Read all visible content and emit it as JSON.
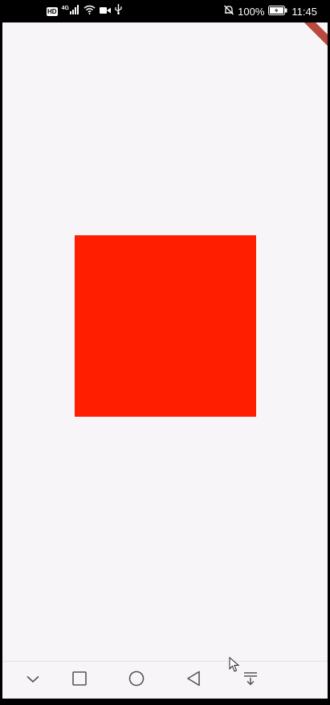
{
  "status_bar": {
    "hd_badge": "HD",
    "network_type": "4G",
    "signal_icon": "signal-bars-icon",
    "wifi_icon": "wifi-icon",
    "camera_icon": "video-camera-icon",
    "usb_icon": "usb-icon",
    "mute_icon": "bell-off-icon",
    "battery_percent": "100%",
    "battery_icon": "battery-charging-icon",
    "time": "11:45"
  },
  "app": {
    "background_color": "#f8f5f9",
    "debug_banner": "debug-ribbon",
    "square_color": "#ff1e00"
  },
  "nav_bar": {
    "buttons": [
      {
        "name": "hide-nav",
        "icon": "chevron-down-icon"
      },
      {
        "name": "recents",
        "icon": "square-icon"
      },
      {
        "name": "home",
        "icon": "circle-icon"
      },
      {
        "name": "back",
        "icon": "triangle-back-icon"
      },
      {
        "name": "notifications",
        "icon": "pull-down-icon"
      }
    ]
  }
}
